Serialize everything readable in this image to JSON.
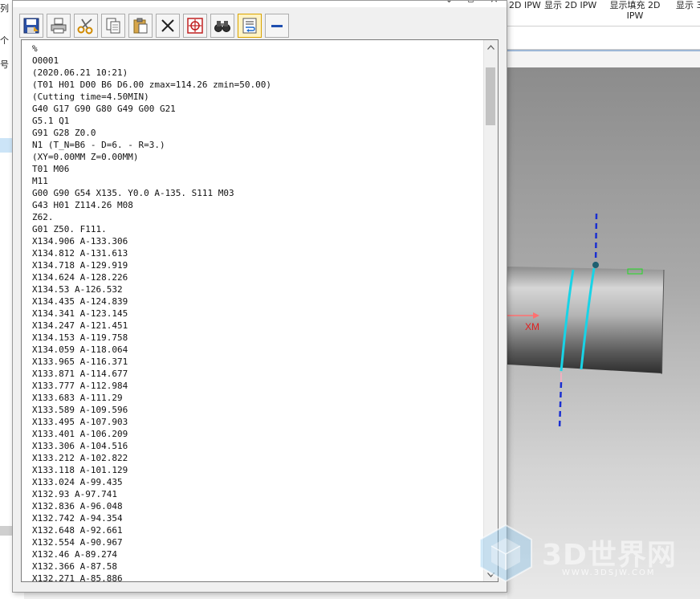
{
  "background_app": {
    "ribbon_labels": [
      "2D IPW",
      "显示 2D IPW",
      "显示填充 2D IPW",
      "显示 3"
    ],
    "viewport": {
      "axis_label": "XM"
    },
    "left_panel": {
      "texts": [
        "列",
        "个",
        "号"
      ]
    }
  },
  "dialog": {
    "toolbar": {
      "buttons": [
        {
          "name": "save-button",
          "icon": "save-icon"
        },
        {
          "name": "print-button",
          "icon": "printer-icon"
        },
        {
          "name": "cut-button",
          "icon": "scissors-icon"
        },
        {
          "name": "copy-button",
          "icon": "copy-icon"
        },
        {
          "name": "paste-button",
          "icon": "clipboard-icon"
        },
        {
          "name": "delete-button",
          "icon": "close-x-icon"
        },
        {
          "name": "target-button",
          "icon": "crosshair-icon"
        },
        {
          "name": "find-button",
          "icon": "binoculars-icon"
        },
        {
          "name": "word-wrap-button",
          "icon": "wrap-icon",
          "active": true
        },
        {
          "name": "minimize-button",
          "icon": "minus-icon"
        }
      ]
    },
    "nc_lines": [
      "%",
      "O0001",
      "(2020.06.21 10:21)",
      "(T01 H01 D00 B6 D6.00 zmax=114.26 zmin=50.00)",
      "(Cutting time=4.50MIN)",
      "G40 G17 G90 G80 G49 G00 G21",
      "G5.1 Q1",
      "G91 G28 Z0.0",
      "N1 (T_N=B6 - D=6. - R=3.)",
      "(XY=0.00MM Z=0.00MM)",
      "T01 M06",
      "M11",
      "G00 G90 G54 X135. Y0.0 A-135. S111 M03",
      "G43 H01 Z114.26 M08",
      "Z62.",
      "G01 Z50. F111.",
      "X134.906 A-133.306",
      "X134.812 A-131.613",
      "X134.718 A-129.919",
      "X134.624 A-128.226",
      "X134.53 A-126.532",
      "X134.435 A-124.839",
      "X134.341 A-123.145",
      "X134.247 A-121.451",
      "X134.153 A-119.758",
      "X134.059 A-118.064",
      "X133.965 A-116.371",
      "X133.871 A-114.677",
      "X133.777 A-112.984",
      "X133.683 A-111.29",
      "X133.589 A-109.596",
      "X133.495 A-107.903",
      "X133.401 A-106.209",
      "X133.306 A-104.516",
      "X133.212 A-102.822",
      "X133.118 A-101.129",
      "X133.024 A-99.435",
      "X132.93 A-97.741",
      "X132.836 A-96.048",
      "X132.742 A-94.354",
      "X132.648 A-92.661",
      "X132.554 A-90.967",
      "X132.46 A-89.274",
      "X132.366 A-87.58",
      "X132.271 A-85.886"
    ]
  },
  "watermark": {
    "text": "3D世界网",
    "url": "WWW.3DSJW.COM"
  },
  "colors": {
    "toolpath": "#19d3e6",
    "axis_dash": "#1a2fd1",
    "axis_label": "#e02020",
    "selection": "#cce4f7",
    "active_button": "#fff3c4"
  }
}
